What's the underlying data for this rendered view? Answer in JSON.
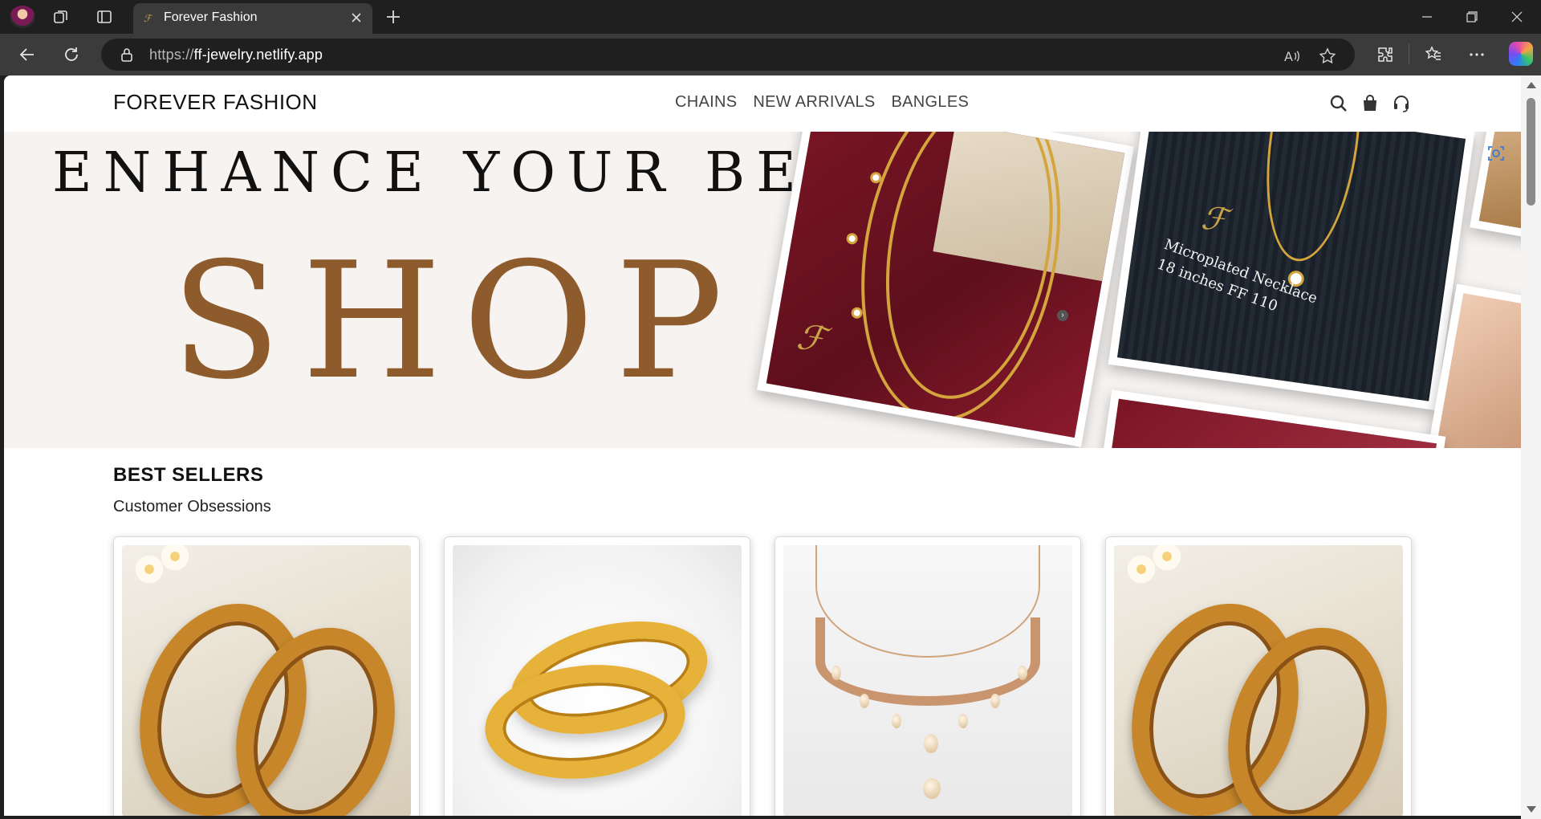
{
  "browser": {
    "tab_title": "Forever Fashion",
    "url_protocol": "https://",
    "url_host": "ff-jewelry.netlify.app"
  },
  "site": {
    "brand": "FOREVER FASHION",
    "nav": [
      "CHAINS",
      "NEW ARRIVALS",
      "BANGLES"
    ]
  },
  "hero": {
    "line1": "ENHANCE YOUR BEAUTY",
    "line2": "SHOP",
    "photo_caption_1": "Microplated Necklace",
    "photo_caption_2": "18 inches FF 110",
    "accent_color": "#8d5b2c"
  },
  "best_sellers": {
    "title": "BEST SELLERS",
    "subtitle": "Customer Obsessions"
  },
  "colors": {
    "chrome_dark": "#1f1f1f",
    "chrome_mid": "#3b3b3b",
    "gold": "#d4a53c"
  }
}
